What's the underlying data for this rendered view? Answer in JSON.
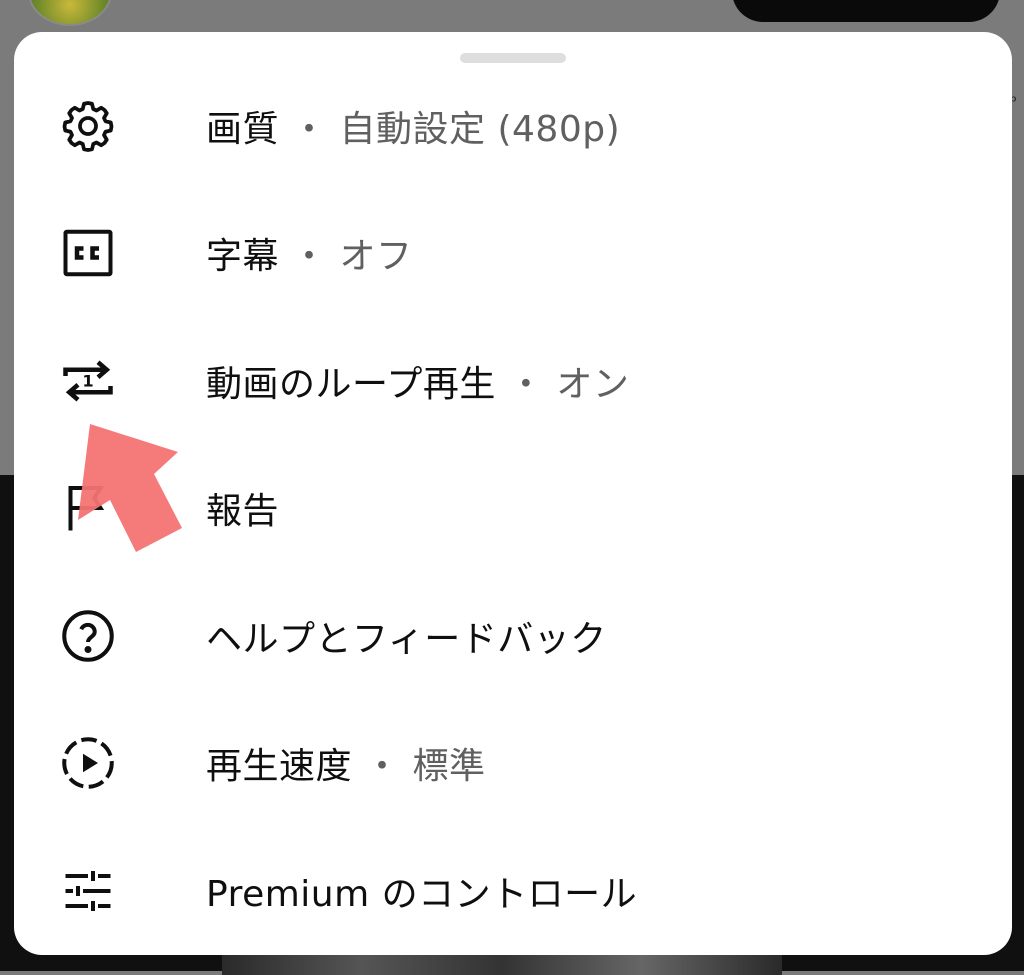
{
  "menu": {
    "items": [
      {
        "icon": "gear-icon",
        "label": "画質",
        "separator": "・",
        "value": "自動設定 (480p)"
      },
      {
        "icon": "closed-captions-icon",
        "label": "字幕",
        "separator": "・",
        "value": "オフ"
      },
      {
        "icon": "repeat-one-icon",
        "label": "動画のループ再生",
        "separator": "・",
        "value": "オン"
      },
      {
        "icon": "flag-icon",
        "label": "報告",
        "separator": "",
        "value": ""
      },
      {
        "icon": "help-circle-icon",
        "label": "ヘルプとフィードバック",
        "separator": "",
        "value": ""
      },
      {
        "icon": "playback-speed-icon",
        "label": "再生速度",
        "separator": "・",
        "value": "標準"
      },
      {
        "icon": "sliders-icon",
        "label": "Premium のコントロール",
        "separator": "",
        "value": ""
      }
    ]
  },
  "repeat_icon_badge": "1",
  "colors": {
    "sheet_background": "#ffffff",
    "label_text": "#0f0f0f",
    "value_text": "#606060",
    "annotation_arrow": "#f47474"
  }
}
